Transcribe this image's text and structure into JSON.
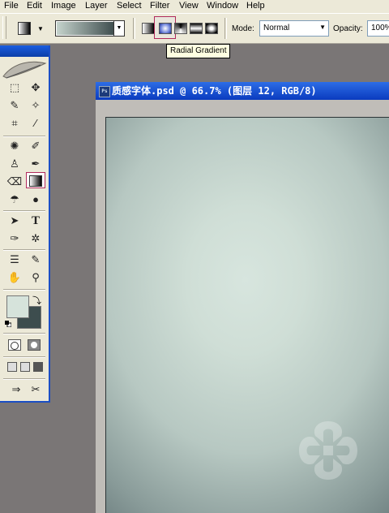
{
  "menu": [
    "File",
    "Edit",
    "Image",
    "Layer",
    "Select",
    "Filter",
    "View",
    "Window",
    "Help"
  ],
  "options": {
    "mode_label": "Mode:",
    "mode_value": "Normal",
    "opacity_label": "Opacity:",
    "opacity_value": "100%",
    "gradient_types": [
      "linear-gradient",
      "radial-gradient",
      "angle-gradient",
      "reflected-gradient",
      "diamond-gradient"
    ],
    "selected_gradient_type": "radial-gradient",
    "gradient_colors": [
      "#c5d3cc",
      "#3c4b4c"
    ]
  },
  "tooltip": "Radial Gradient",
  "document": {
    "title": "质感字体.psd @ 66.7% (图层 12, RGB/8)"
  },
  "toolbox": {
    "active_tool": "gradient-tool",
    "foreground_color": "#d6e3db",
    "background_color": "#3d4d4e"
  }
}
